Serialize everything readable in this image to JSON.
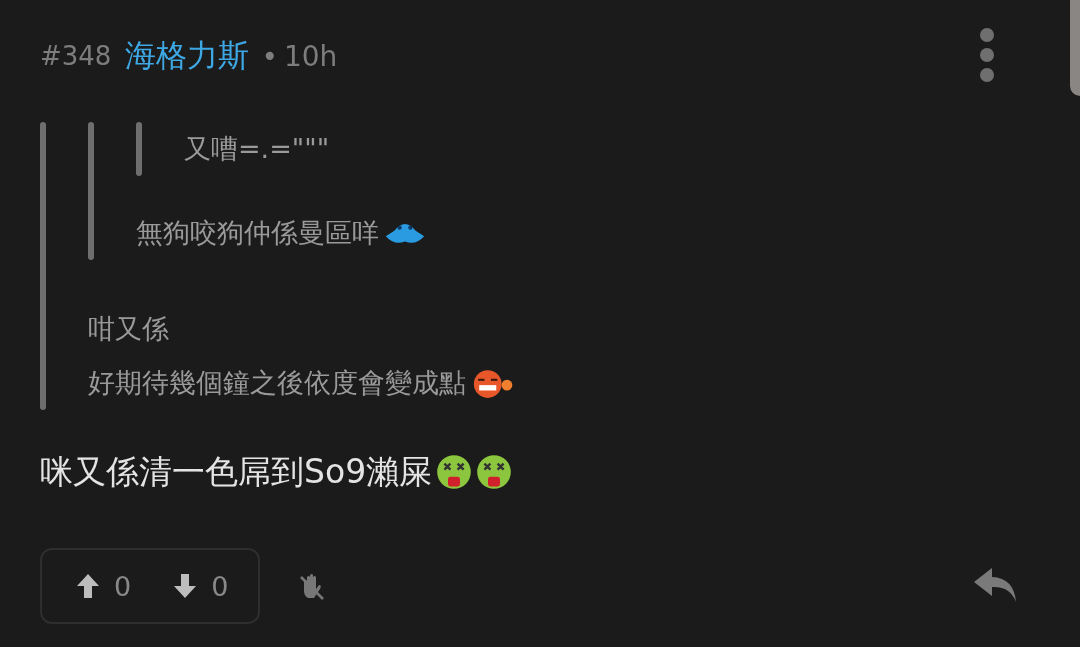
{
  "post": {
    "number": "#348",
    "author": "海格力斯",
    "separator": "•",
    "time": "10h"
  },
  "quote": {
    "quote": {
      "quote": {
        "lines": [
          {
            "text": "又嘈=.=\"\"\""
          }
        ]
      },
      "lines": [
        {
          "text": "無狗咬狗仲係曼區咩",
          "emojis": [
            {
              "kind": "saucer"
            }
          ]
        }
      ]
    },
    "lines": [
      {
        "text": "咁又係"
      },
      {
        "text": "好期待幾個鐘之後依度會變成點",
        "emojis": [
          {
            "kind": "bomb"
          }
        ]
      }
    ]
  },
  "body": {
    "text": "咪又係清一色屌到So9瀨屎",
    "emojis": [
      {
        "kind": "sick"
      },
      {
        "kind": "sick"
      }
    ]
  },
  "votes": {
    "up": "0",
    "down": "0"
  }
}
